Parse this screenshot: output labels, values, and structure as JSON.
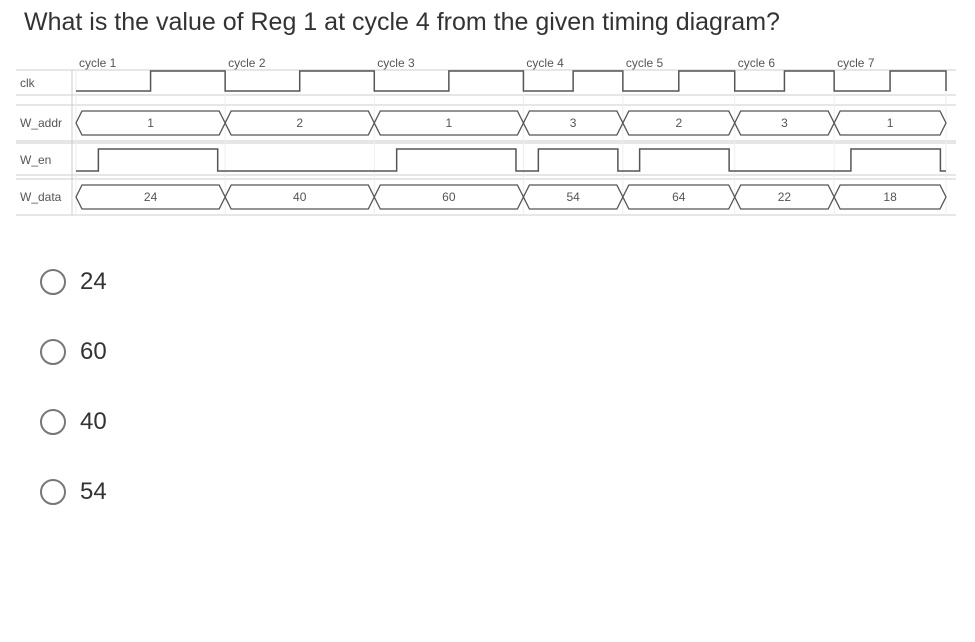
{
  "question": "What is the value of Reg 1 at cycle 4 from the given timing diagram?",
  "cycles": [
    "cycle 1",
    "cycle 2",
    "cycle 3",
    "cycle 4",
    "cycle 5",
    "cycle 6",
    "cycle 7"
  ],
  "signals": {
    "clk": {
      "label": "clk"
    },
    "w_addr": {
      "label": "W_addr",
      "values": [
        "1",
        "2",
        "1",
        "3",
        "2",
        "3",
        "1"
      ]
    },
    "w_en": {
      "label": "W_en",
      "levels": [
        1,
        0,
        1,
        1,
        1,
        0,
        1
      ]
    },
    "w_data": {
      "label": "W_data",
      "values": [
        "24",
        "40",
        "60",
        "54",
        "64",
        "22",
        "18"
      ]
    }
  },
  "options": [
    "24",
    "60",
    "40",
    "54"
  ],
  "chart_data": {
    "type": "table",
    "title": "Register file write timing diagram",
    "columns": [
      "cycle",
      "W_addr",
      "W_en",
      "W_data"
    ],
    "rows": [
      {
        "cycle": 1,
        "W_addr": 1,
        "W_en": 1,
        "W_data": 24
      },
      {
        "cycle": 2,
        "W_addr": 2,
        "W_en": 0,
        "W_data": 40
      },
      {
        "cycle": 3,
        "W_addr": 1,
        "W_en": 1,
        "W_data": 60
      },
      {
        "cycle": 4,
        "W_addr": 3,
        "W_en": 1,
        "W_data": 54
      },
      {
        "cycle": 5,
        "W_addr": 2,
        "W_en": 1,
        "W_data": 64
      },
      {
        "cycle": 6,
        "W_addr": 3,
        "W_en": 0,
        "W_data": 22
      },
      {
        "cycle": 7,
        "W_addr": 1,
        "W_en": 1,
        "W_data": 18
      }
    ]
  }
}
